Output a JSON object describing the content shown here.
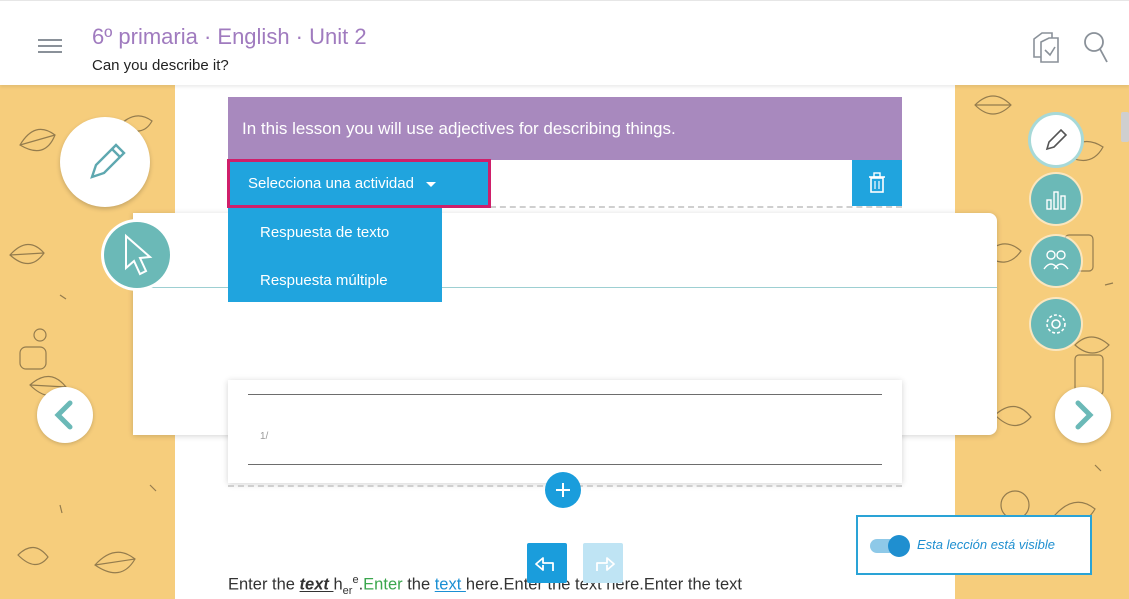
{
  "header": {
    "course_title": "6º primaria · English · Unit 2",
    "lesson_title": "Can you describe it?",
    "icons": [
      "menu-icon",
      "copy-pages-icon",
      "search-icon"
    ]
  },
  "banner": {
    "text": "In this lesson you will use adjectives for describing things."
  },
  "activity_selector": {
    "label": "Selecciona una actividad",
    "options": [
      "Respuesta de texto",
      "Respuesta múltiple"
    ]
  },
  "editor": {
    "page_number": "1/"
  },
  "visibility": {
    "label": "Esta lección está visible",
    "on": true
  },
  "body_text": {
    "part1": "Enter the ",
    "bold_link": "text ",
    "h": "h",
    "er": "er",
    "e": "e",
    "dot1": ".",
    "green_enter": "Enter",
    "part2": " the ",
    "blue_link": "text ",
    "part3": "here.Enter the text here.Enter the text"
  },
  "colors": {
    "accent_blue": "#20a4de",
    "purple": "#a889be",
    "teal": "#6bb9b7",
    "side_yellow": "#f6cd7c",
    "highlight": "#cf1f6a"
  }
}
